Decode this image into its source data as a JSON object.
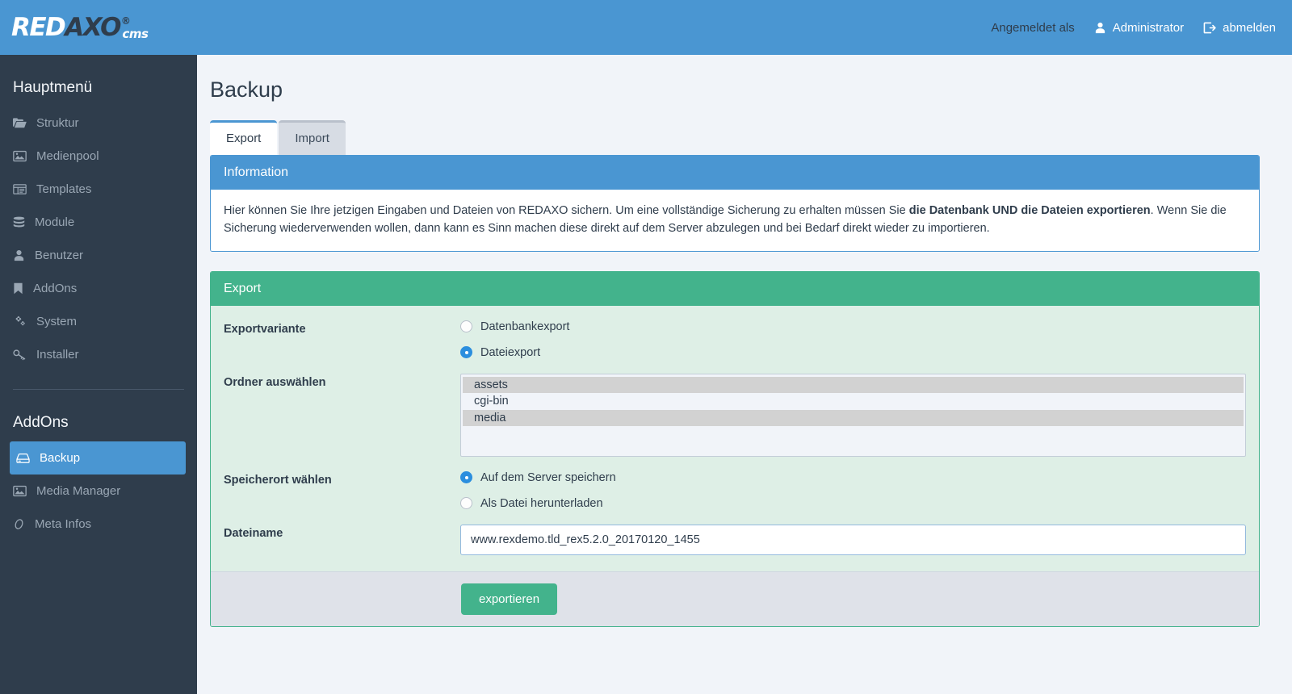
{
  "brand": {
    "name_red": "RED",
    "name_axo": "AXO",
    "registered": "®",
    "suffix": "cms"
  },
  "header": {
    "logged_in_label": "Angemeldet als",
    "user_name": "Administrator",
    "user_icon": "user-icon",
    "logout_label": "abmelden",
    "logout_icon": "sign-out-icon",
    "background_color": "#4a96d2"
  },
  "sidebar": {
    "main_title": "Hauptmenü",
    "main_items": [
      {
        "label": "Struktur",
        "icon": "folder-open-icon"
      },
      {
        "label": "Medienpool",
        "icon": "image-icon"
      },
      {
        "label": "Templates",
        "icon": "window-grid-icon"
      },
      {
        "label": "Module",
        "icon": "database-stack-icon"
      },
      {
        "label": "Benutzer",
        "icon": "user-icon"
      },
      {
        "label": "AddOns",
        "icon": "bookmark-icon"
      },
      {
        "label": "System",
        "icon": "gears-icon"
      },
      {
        "label": "Installer",
        "icon": "wrench-key-icon"
      }
    ],
    "addons_title": "AddOns",
    "addons_items": [
      {
        "label": "Backup",
        "icon": "hard-drive-icon",
        "active": true
      },
      {
        "label": "Media Manager",
        "icon": "image-icon",
        "active": false
      },
      {
        "label": "Meta Infos",
        "icon": "tag-icon",
        "active": false
      }
    ],
    "background_color": "#2f3d4c",
    "active_color": "#4a96d2"
  },
  "main": {
    "page_title": "Backup",
    "tabs": [
      {
        "label": "Export",
        "active": true
      },
      {
        "label": "Import",
        "active": false
      }
    ],
    "info_panel": {
      "title": "Information",
      "text_before": "Hier können Sie Ihre jetzigen Eingaben und Dateien von REDAXO sichern. Um eine vollständige Sicherung zu erhalten müssen Sie ",
      "text_bold": "die Datenbank UND die Dateien exportieren",
      "text_after": ". Wenn Sie die Sicherung wiederverwenden wollen, dann kann es Sinn machen diese direkt auf dem Server abzulegen und bei Bedarf direkt wieder zu importieren.",
      "accent_color": "#4a96d2"
    },
    "export_panel": {
      "title": "Export",
      "accent_color": "#43b38c",
      "rows": {
        "exportvariante": {
          "label": "Exportvariante",
          "options": [
            {
              "label": "Datenbankexport",
              "selected": false
            },
            {
              "label": "Dateiexport",
              "selected": true
            }
          ]
        },
        "ordner": {
          "label": "Ordner auswählen",
          "options": [
            {
              "label": "assets",
              "selected": true
            },
            {
              "label": "cgi-bin",
              "selected": false
            },
            {
              "label": "media",
              "selected": true
            }
          ]
        },
        "speicherort": {
          "label": "Speicherort wählen",
          "options": [
            {
              "label": "Auf dem Server speichern",
              "selected": true
            },
            {
              "label": "Als Datei herunterladen",
              "selected": false
            }
          ]
        },
        "dateiname": {
          "label": "Dateiname",
          "value": "www.rexdemo.tld_rex5.2.0_20170120_1455"
        }
      },
      "submit_label": "exportieren"
    }
  }
}
